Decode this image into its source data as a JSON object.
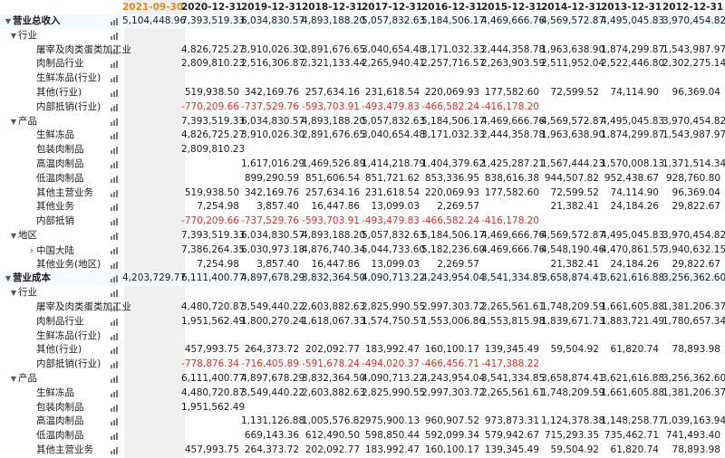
{
  "periods": [
    "2021-09-30",
    "2020-12-31",
    "2019-12-31",
    "2018-12-31",
    "2017-12-31",
    "2016-12-31",
    "2015-12-31",
    "2014-12-31",
    "2013-12-31",
    "2012-12-31"
  ],
  "selected_period": "2021-09-30",
  "colors": {
    "selected_header": "#e08a1e",
    "negative": "#d6322a"
  },
  "rows": [
    {
      "label": "营业总收入",
      "level": 0,
      "caret": "down",
      "values": [
        "5,104,448.96",
        "7,393,519.33",
        "6,034,830.57",
        "4,893,188.20",
        "5,057,832.63",
        "5,184,506.17",
        "4,469,666.76",
        "4,569,572.87",
        "4,495,045.83",
        "3,970,454.82"
      ]
    },
    {
      "label": "行业",
      "level": 1,
      "caret": "down",
      "values": [
        "",
        "",
        "",
        "",
        "",
        "",
        "",
        "",
        "",
        ""
      ]
    },
    {
      "label": "屠宰及肉类蛋类加工业",
      "level": 2,
      "caret": "",
      "values": [
        "",
        "4,826,725.27",
        "3,910,026.30",
        "2,891,676.65",
        "3,040,654.48",
        "3,171,032.33",
        "2,444,358.78",
        "1,963,638.90",
        "1,874,299.87",
        "1,543,987.97"
      ]
    },
    {
      "label": "肉制品行业",
      "level": 2,
      "caret": "",
      "values": [
        "",
        "2,809,810.23",
        "2,516,306.87",
        "2,321,133.44",
        "2,265,940.41",
        "2,257,716.57",
        "2,263,903.59",
        "2,511,952.04",
        "2,522,446.80",
        "2,302,275.14"
      ]
    },
    {
      "label": "生鲜冻品(行业)",
      "level": 2,
      "caret": "",
      "values": [
        "",
        "",
        "",
        "",
        "",
        "",
        "",
        "",
        "",
        ""
      ]
    },
    {
      "label": "其他(行业)",
      "level": 2,
      "caret": "",
      "values": [
        "",
        "519,938.50",
        "342,169.76",
        "257,634.16",
        "231,618.54",
        "220,069.93",
        "177,582.60",
        "72,599.52",
        "74,114.90",
        "96,369.04"
      ]
    },
    {
      "label": "内部抵销(行业)",
      "level": 2,
      "caret": "",
      "values": [
        "",
        "-770,209.66",
        "-737,529.76",
        "-593,703.91",
        "-493,479.83",
        "-466,582.24",
        "-416,178.20",
        "",
        "",
        ""
      ]
    },
    {
      "label": "产品",
      "level": 1,
      "caret": "down",
      "values": [
        "",
        "7,393,519.33",
        "6,034,830.57",
        "4,893,188.20",
        "5,057,832.63",
        "5,184,506.17",
        "4,469,666.76",
        "4,569,572.87",
        "4,495,045.83",
        "3,970,454.82"
      ]
    },
    {
      "label": "生鲜冻品",
      "level": 2,
      "caret": "",
      "values": [
        "",
        "4,826,725.27",
        "3,910,026.30",
        "2,891,676.65",
        "3,040,654.48",
        "3,171,032.33",
        "2,444,358.78",
        "1,963,638.90",
        "1,874,299.87",
        "1,543,987.97"
      ]
    },
    {
      "label": "包装肉制品",
      "level": 2,
      "caret": "",
      "values": [
        "",
        "2,809,810.23",
        "",
        "",
        "",
        "",
        "",
        "",
        "",
        ""
      ]
    },
    {
      "label": "高温肉制品",
      "level": 2,
      "caret": "",
      "values": [
        "",
        "",
        "1,617,016.29",
        "1,469,526.89",
        "1,414,218.79",
        "1,404,379.62",
        "1,425,287.21",
        "1,567,444.23",
        "1,570,008.13",
        "1,371,514.34"
      ]
    },
    {
      "label": "低温肉制品",
      "level": 2,
      "caret": "",
      "values": [
        "",
        "",
        "899,290.59",
        "851,606.54",
        "851,721.62",
        "853,336.95",
        "838,616.38",
        "944,507.82",
        "952,438.67",
        "928,760.80"
      ]
    },
    {
      "label": "其他主营业务",
      "level": 2,
      "caret": "",
      "values": [
        "",
        "519,938.50",
        "342,169.76",
        "257,634.16",
        "231,618.54",
        "220,069.93",
        "177,582.60",
        "72,599.52",
        "74,114.90",
        "96,369.04"
      ]
    },
    {
      "label": "其他业务",
      "level": 2,
      "caret": "",
      "values": [
        "",
        "7,254.98",
        "3,857.40",
        "16,447.86",
        "13,099.03",
        "2,269.57",
        "",
        "21,382.41",
        "24,184.26",
        "29,822.67"
      ]
    },
    {
      "label": "内部抵销",
      "level": 2,
      "caret": "",
      "values": [
        "",
        "-770,209.66",
        "-737,529.76",
        "-593,703.91",
        "-493,479.83",
        "-466,582.24",
        "-416,178.20",
        "",
        "",
        ""
      ]
    },
    {
      "label": "地区",
      "level": 1,
      "caret": "down",
      "values": [
        "",
        "7,393,519.33",
        "6,034,830.57",
        "4,893,188.20",
        "5,057,832.63",
        "5,184,506.17",
        "4,469,666.76",
        "4,569,572.87",
        "4,495,045.83",
        "3,970,454.82"
      ]
    },
    {
      "label": "中国大陆",
      "level": 2,
      "caret": "right",
      "values": [
        "",
        "7,386,264.35",
        "6,030,973.18",
        "4,876,740.34",
        "5,044,733.60",
        "5,182,236.60",
        "4,469,666.76",
        "4,548,190.46",
        "4,470,861.57",
        "3,940,632.15"
      ]
    },
    {
      "label": "其他业务(地区)",
      "level": 2,
      "caret": "",
      "values": [
        "",
        "7,254.98",
        "3,857.40",
        "16,447.86",
        "13,099.03",
        "2,269.57",
        "",
        "21,382.41",
        "24,184.26",
        "29,822.67"
      ]
    },
    {
      "label": "营业成本",
      "level": 0,
      "caret": "down",
      "values": [
        "4,203,729.77",
        "6,111,400.77",
        "4,897,678.29",
        "3,832,364.50",
        "4,090,713.22",
        "4,243,954.04",
        "3,541,334.85",
        "3,658,874.41",
        "3,621,616.88",
        "3,256,362.60"
      ]
    },
    {
      "label": "行业",
      "level": 1,
      "caret": "down",
      "values": [
        "",
        "",
        "",
        "",
        "",
        "",
        "",
        "",
        "",
        ""
      ]
    },
    {
      "label": "屠宰及肉类蛋类加工业",
      "level": 2,
      "caret": "",
      "values": [
        "",
        "4,480,720.87",
        "3,549,440.22",
        "2,603,882.63",
        "2,825,990.55",
        "2,997,303.72",
        "2,265,561.61",
        "1,748,209.59",
        "1,661,605.88",
        "1,381,206.37"
      ]
    },
    {
      "label": "肉制品行业",
      "level": 2,
      "caret": "",
      "values": [
        "",
        "1,951,562.49",
        "1,800,270.24",
        "1,618,067.33",
        "1,574,750.57",
        "1,553,006.86",
        "1,553,815.98",
        "1,839,671.73",
        "1,883,721.49",
        "1,780,657.34"
      ]
    },
    {
      "label": "生鲜冻品(行业)",
      "level": 2,
      "caret": "",
      "values": [
        "",
        "",
        "",
        "",
        "",
        "",
        "",
        "",
        "",
        ""
      ]
    },
    {
      "label": "其他(行业)",
      "level": 2,
      "caret": "",
      "values": [
        "",
        "457,993.75",
        "264,373.72",
        "202,092.77",
        "183,992.47",
        "160,100.17",
        "139,345.49",
        "59,504.92",
        "61,820.74",
        "78,893.98"
      ]
    },
    {
      "label": "内部抵销(行业)",
      "level": 2,
      "caret": "",
      "values": [
        "",
        "-778,876.34",
        "-716,405.89",
        "-591,678.24",
        "-494,020.37",
        "-466,456.71",
        "-417,388.22",
        "",
        "",
        ""
      ]
    },
    {
      "label": "产品",
      "level": 1,
      "caret": "down",
      "values": [
        "",
        "6,111,400.77",
        "4,897,678.29",
        "3,832,364.50",
        "4,090,713.22",
        "4,243,954.04",
        "3,541,334.85",
        "3,658,874.41",
        "3,621,616.88",
        "3,256,362.60"
      ]
    },
    {
      "label": "生鲜冻品",
      "level": 2,
      "caret": "",
      "values": [
        "",
        "4,480,720.87",
        "3,549,440.22",
        "2,603,882.63",
        "2,825,990.55",
        "2,997,303.72",
        "2,265,561.61",
        "1,748,209.59",
        "1,661,605.88",
        "1,381,206.37"
      ]
    },
    {
      "label": "包装肉制品",
      "level": 2,
      "caret": "",
      "values": [
        "",
        "1,951,562.49",
        "",
        "",
        "",
        "",
        "",
        "",
        "",
        ""
      ]
    },
    {
      "label": "高温肉制品",
      "level": 2,
      "caret": "",
      "values": [
        "",
        "",
        "1,131,126.88",
        "1,005,576.82",
        "975,900.13",
        "960,907.52",
        "973,873.31",
        "1,124,378.38",
        "1,148,258.77",
        "1,039,163.94"
      ]
    },
    {
      "label": "低温肉制品",
      "level": 2,
      "caret": "",
      "values": [
        "",
        "",
        "669,143.36",
        "612,490.50",
        "598,850.44",
        "592,099.34",
        "579,942.67",
        "715,293.35",
        "735,462.71",
        "741,493.40"
      ]
    },
    {
      "label": "其他主营业务",
      "level": 2,
      "caret": "",
      "values": [
        "",
        "457,993.75",
        "264,373.72",
        "202,092.77",
        "183,992.47",
        "160,100.17",
        "139,345.49",
        "59,504.92",
        "61,820.74",
        "78,893.98"
      ]
    }
  ]
}
